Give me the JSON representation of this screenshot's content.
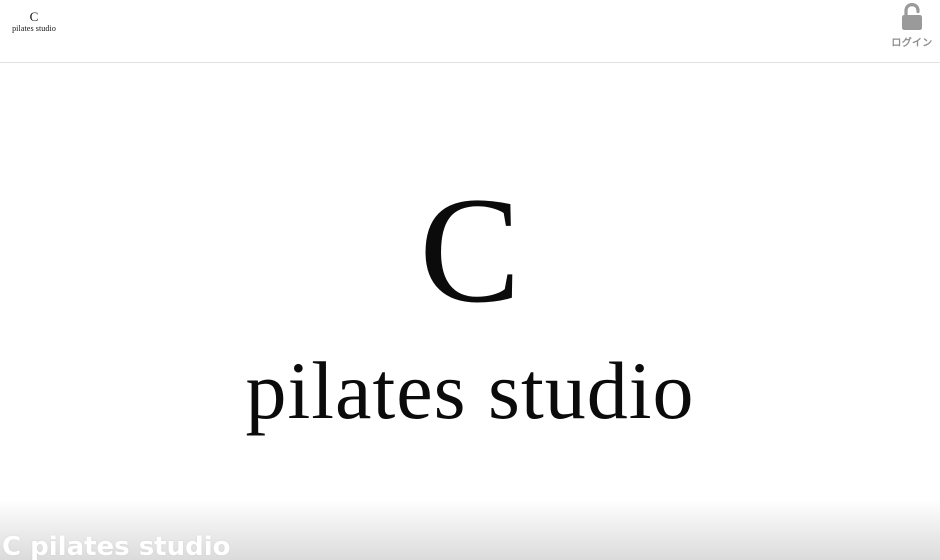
{
  "header": {
    "logo": {
      "mark": "C",
      "word": "pilates studio"
    },
    "login": {
      "icon": "unlocked-padlock-icon",
      "label": "ログイン"
    }
  },
  "hero": {
    "logo": {
      "mark": "C",
      "word": "pilates studio"
    },
    "title": "C pilates studio"
  },
  "colors": {
    "background": "#ffffff",
    "header_border": "#e2e2e2",
    "icon_gray": "#9a9a9a",
    "logo_black": "#0b0b0b",
    "title_text": "#ffffff"
  }
}
